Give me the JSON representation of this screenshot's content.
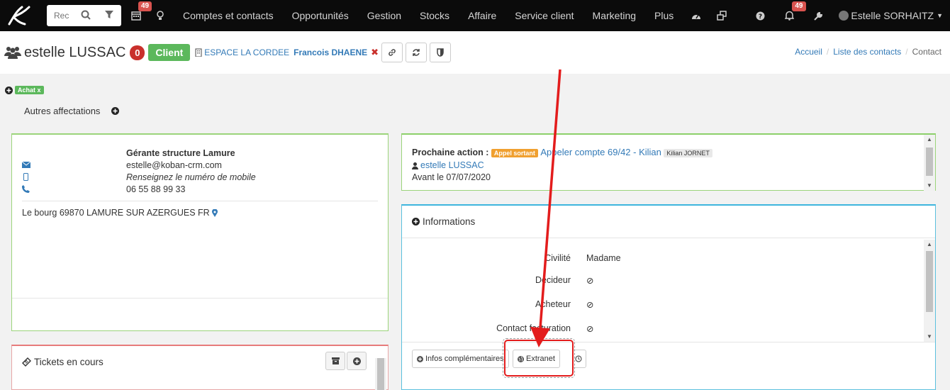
{
  "nav": {
    "search_placeholder": "Rec",
    "calendar_badge": "49",
    "menu": [
      "Comptes et contacts",
      "Opportunités",
      "Gestion",
      "Stocks",
      "Affaire",
      "Service client",
      "Marketing",
      "Plus"
    ],
    "notif_badge": "49",
    "user_name": "Estelle SORHAITZ"
  },
  "header": {
    "contact_name": "estelle LUSSAC",
    "count": "0",
    "status_label": "Client",
    "company": "ESPACE LA CORDEE",
    "owner": "Francois DHAENE",
    "remove_mark": "✖",
    "breadcrumb": [
      "Accueil",
      "Liste des contacts",
      "Contact"
    ]
  },
  "tags": {
    "achat": "Achat x",
    "autres_label": "Autres affectations"
  },
  "contact": {
    "job_title": "Gérante structure Lamure",
    "email": "estelle@koban-crm.com",
    "mobile_placeholder": "Renseignez le numéro de mobile",
    "phone": "06 55 88 99 33",
    "address": "Le bourg 69870 LAMURE SUR AZERGUES FR"
  },
  "next_action": {
    "label": "Prochaine action :",
    "type_tag": "Appel sortant",
    "subject": "Appeler compte 69/42 - Kilian",
    "assignee": "Kilian JORNET",
    "contact": "estelle LUSSAC",
    "due": "Avant le 07/07/2020"
  },
  "informations": {
    "title": "Informations",
    "rows": [
      {
        "key": "Civilité",
        "value": "Madame"
      },
      {
        "key": "Décideur",
        "value": "⊘"
      },
      {
        "key": "Acheteur",
        "value": "⊘"
      },
      {
        "key": "Contact facturation",
        "value": "⊘"
      }
    ],
    "btn_infos": "Infos complémentaires",
    "btn_extranet": "Extranet"
  },
  "tickets": {
    "title": "Tickets en cours"
  },
  "colors": {
    "nav_bg": "#0b0b0b",
    "client_green": "#5cb85c",
    "badge_red": "#d9534f",
    "link_blue": "#337ab7",
    "annotation_red": "#e31c1c"
  }
}
